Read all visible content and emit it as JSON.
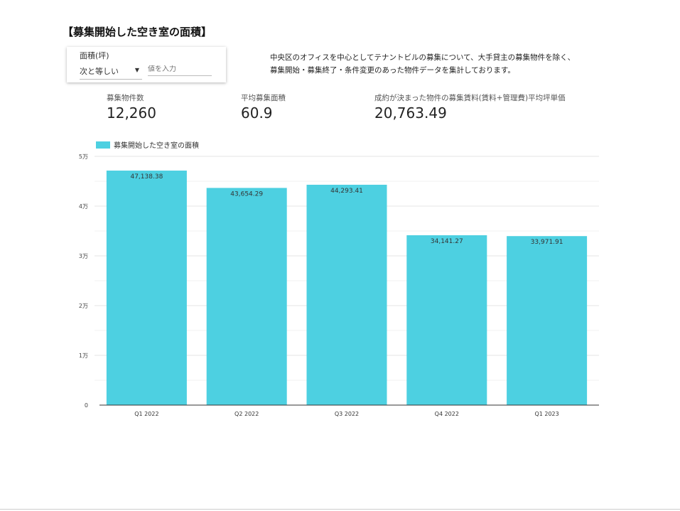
{
  "title": "【募集開始した空き室の面積】",
  "filter": {
    "label": "面積(坪)",
    "operator": "次と等しい",
    "value": "",
    "placeholder": "値を入力"
  },
  "description": [
    "中央区のオフィスを中心としてテナントビルの募集について、大手貸主の募集物件を除く、",
    "募集開始・募集終了・条件変更のあった物件データを集計しております。"
  ],
  "kpis": [
    {
      "label": "募集物件数",
      "value": "12,260"
    },
    {
      "label": "平均募集面積",
      "value": "60.9"
    },
    {
      "label": "成約が決まった物件の募集賃料(賃料+管理費)平均坪単価",
      "value": "20,763.49"
    }
  ],
  "chart_data": {
    "type": "bar",
    "categories": [
      "Q1 2022",
      "Q2 2022",
      "Q3 2022",
      "Q4 2022",
      "Q1 2023"
    ],
    "series": [
      {
        "name": "募集開始した空き室の面積",
        "values": [
          47138.38,
          43654.29,
          44293.41,
          34141.27,
          33971.91
        ]
      }
    ],
    "value_labels": [
      "47,138.38",
      "43,654.29",
      "44,293.41",
      "34,141.27",
      "33,971.91"
    ],
    "ylim": [
      0,
      50000
    ],
    "yticks": [
      0,
      10000,
      20000,
      30000,
      40000,
      50000
    ],
    "ytick_labels": [
      "0",
      "1万",
      "2万",
      "3万",
      "4万",
      "5万"
    ],
    "grid": true,
    "legend": "top-left",
    "color": "#4dd0e1"
  }
}
